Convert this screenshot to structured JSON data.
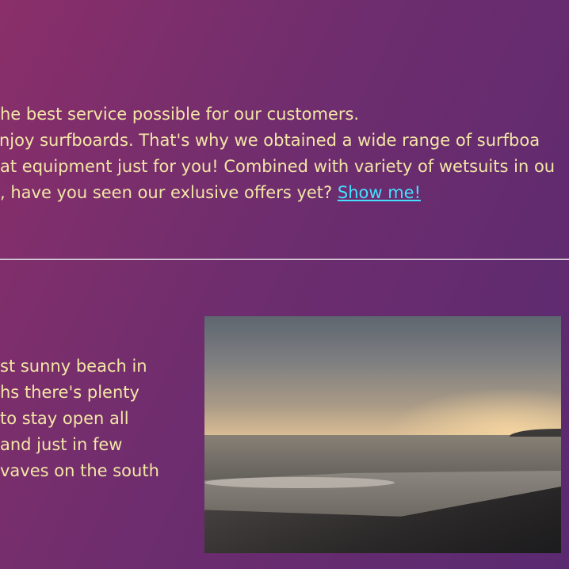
{
  "intro": {
    "line_1": "he best service possible for our customers.",
    "line_2": "njoy surfboards. That's why we obtained a wide range of surfboa",
    "line_3": "at equipment just for you! Combined with variety of wetsuits in ou",
    "line_4": ", have you seen our exlusive offers yet? ",
    "show_me_link": "Show me!"
  },
  "beach": {
    "lines": [
      "st sunny beach in",
      "hs there's plenty",
      " to stay open all",
      "and just in few",
      "vaves on the south"
    ]
  },
  "colors": {
    "background_start": "#8a2f6a",
    "background_end": "#5a2a70",
    "text": "#f3e6a6",
    "link": "#45e0ff"
  }
}
